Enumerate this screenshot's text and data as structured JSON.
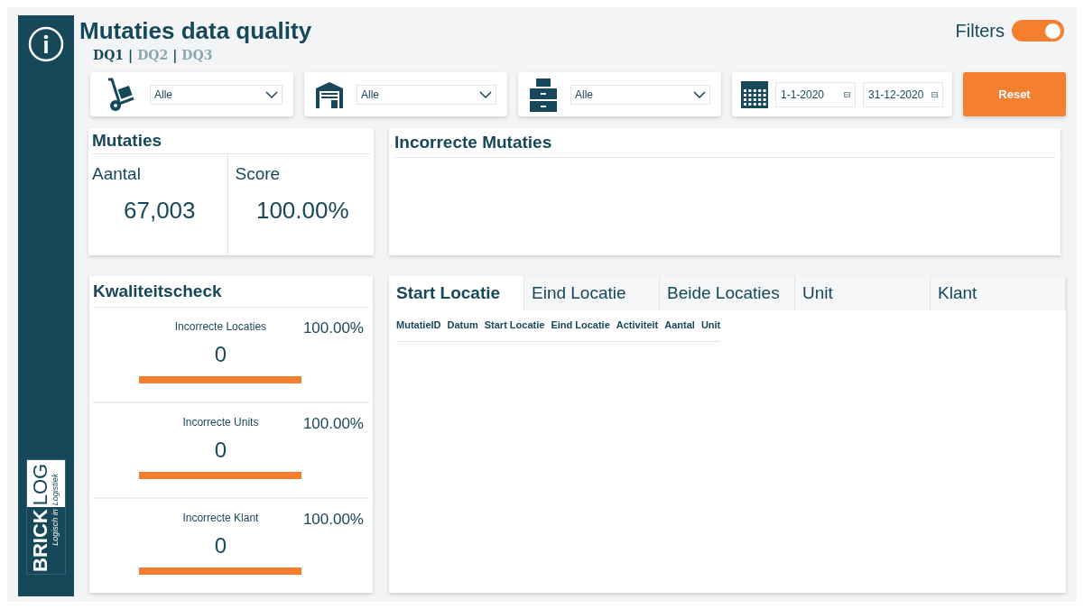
{
  "title": "Mutaties data quality",
  "filters_toggle": {
    "label": "Filters",
    "on": true
  },
  "page_separator": "|",
  "pages": [
    {
      "label": "DQ1",
      "selected": true
    },
    {
      "label": "DQ2",
      "selected": false
    },
    {
      "label": "DQ3",
      "selected": false
    }
  ],
  "slicers": [
    {
      "value": "Alle"
    },
    {
      "value": "Alle"
    },
    {
      "value": "Alle"
    }
  ],
  "date_range": {
    "from": "1-1-2020",
    "to": "31-12-2020"
  },
  "reset_button": "Reset",
  "mutaties": {
    "title": "Mutaties",
    "metrics": [
      {
        "label": "Aantal",
        "value": "67,003"
      },
      {
        "label": "Score",
        "value": "100.00%"
      }
    ]
  },
  "incorrecte_mutaties": {
    "title": "Incorrecte Mutaties"
  },
  "kwaliteitscheck": {
    "title": "Kwaliteitscheck",
    "checks": [
      {
        "label": "Incorrecte Locaties",
        "score": "100.00%",
        "count": "0",
        "level": 1
      },
      {
        "label": "Incorrecte Units",
        "score": "100.00%",
        "count": "0",
        "level": 1
      },
      {
        "label": "Incorrecte Klant",
        "score": "100.00%",
        "count": "0",
        "level": 1
      }
    ]
  },
  "detail": {
    "tabs": [
      {
        "label": "Start Locatie",
        "selected": true
      },
      {
        "label": "Eind Locatie",
        "selected": false
      },
      {
        "label": "Beide Locaties",
        "selected": false
      },
      {
        "label": "Unit",
        "selected": false
      },
      {
        "label": "Klant",
        "selected": false
      }
    ],
    "columns": [
      "MutatieID",
      "Datum",
      "Start Locatie",
      "Eind Locatie",
      "Activiteit",
      "Aantal",
      "Unit"
    ]
  },
  "logo": {
    "brand_left": "BRICK",
    "brand_right": "LOG",
    "tagline_left": "Logisch in",
    "tagline_right": "Logistiek"
  }
}
